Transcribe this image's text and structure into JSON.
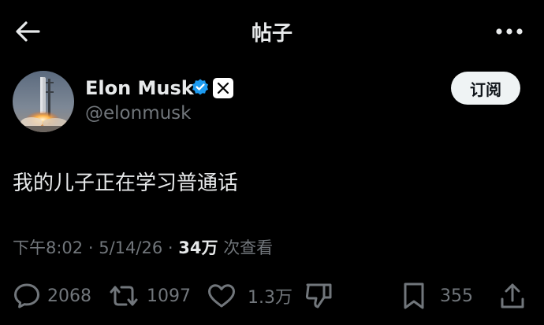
{
  "header": {
    "title": "帖子",
    "back_icon": "arrow-left-icon",
    "more_icon": "more-horizontal-icon"
  },
  "author": {
    "name": "Elon Musk",
    "handle": "@elonmusk",
    "verified_icon": "verified-badge-icon",
    "affiliate_icon": "x-logo-icon",
    "subscribe_label": "订阅"
  },
  "post": {
    "text": "我的儿子正在学习普通话",
    "time": "下午8:02",
    "date": "5/14/26",
    "separator": "·",
    "views": "34万",
    "views_suffix": "次查看"
  },
  "actions": {
    "replies": "2068",
    "reposts": "1097",
    "likes": "1.3万",
    "bookmarks": "355"
  },
  "colors": {
    "background": "#000000",
    "text_primary": "#e7e9ea",
    "text_secondary": "#71767b",
    "verified_blue": "#1d9bf0",
    "button_bg": "#eff3f4"
  }
}
